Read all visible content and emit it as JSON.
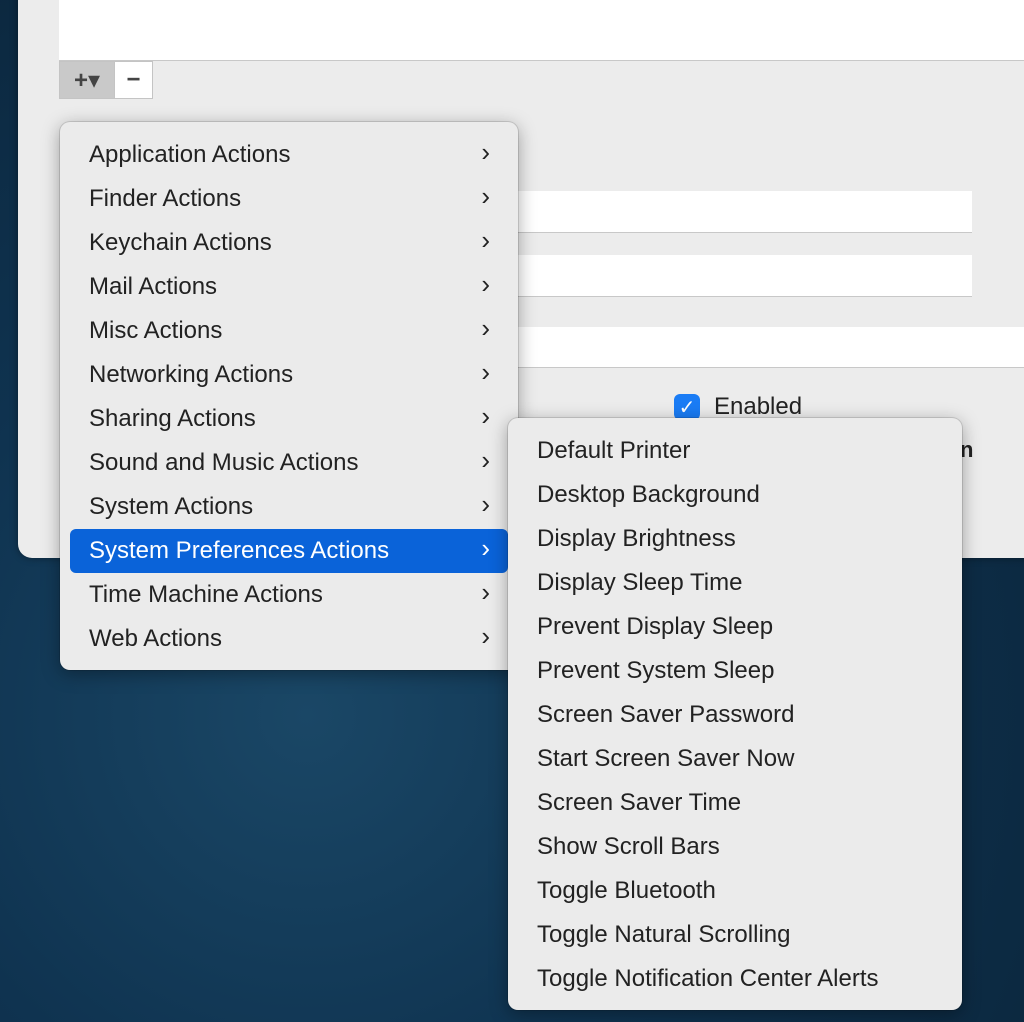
{
  "toolbar": {
    "add_label": "+▾",
    "remove_label": "−"
  },
  "form": {
    "enabled_label": "Enabled",
    "enabled_checked": true,
    "partial_text": "n"
  },
  "menu": {
    "items": [
      {
        "label": "Application Actions"
      },
      {
        "label": "Finder Actions"
      },
      {
        "label": "Keychain Actions"
      },
      {
        "label": "Mail Actions"
      },
      {
        "label": "Misc Actions"
      },
      {
        "label": "Networking Actions"
      },
      {
        "label": "Sharing Actions"
      },
      {
        "label": "Sound and Music Actions"
      },
      {
        "label": "System Actions"
      },
      {
        "label": "System Preferences Actions",
        "selected": true
      },
      {
        "label": "Time Machine Actions"
      },
      {
        "label": "Web Actions"
      }
    ],
    "chevron": "›"
  },
  "submenu": {
    "items": [
      "Default Printer",
      "Desktop Background",
      "Display Brightness",
      "Display Sleep Time",
      "Prevent Display Sleep",
      "Prevent System Sleep",
      "Screen Saver Password",
      "Start Screen Saver Now",
      "Screen Saver Time",
      "Show Scroll Bars",
      "Toggle Bluetooth",
      "Toggle Natural Scrolling",
      "Toggle Notification Center Alerts"
    ]
  },
  "colors": {
    "accent": "#0a63d9",
    "checkbox": "#1a7cf5"
  }
}
